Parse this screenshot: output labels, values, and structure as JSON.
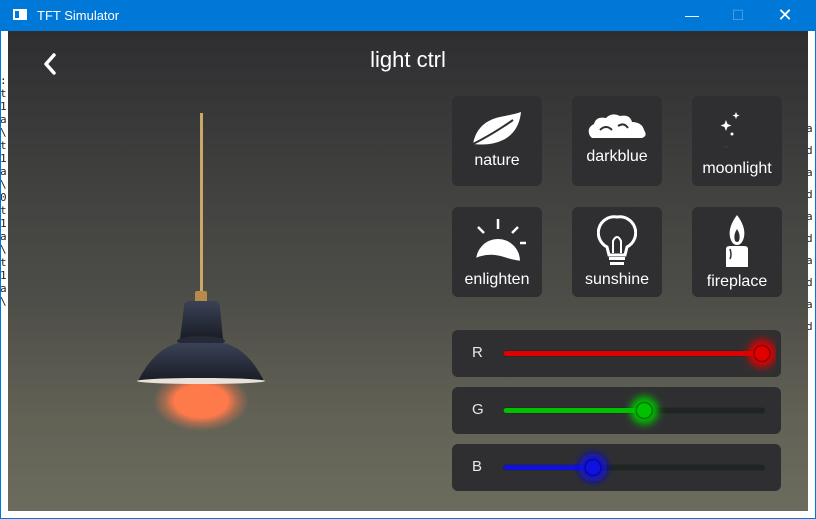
{
  "window": {
    "title": "TFT Simulator",
    "minimize_glyph": "—",
    "maximize_glyph": "☐",
    "close_glyph": "✕"
  },
  "console_left": [
    ":",
    "t",
    "1",
    "a",
    "\\",
    "t",
    "1",
    "a",
    "\\",
    "0",
    "t",
    "1",
    "a",
    "\\",
    "t",
    "1",
    "a",
    "\\"
  ],
  "console_right": [
    "a",
    "d",
    "a",
    "d",
    "a",
    "d",
    "a",
    "d",
    "a",
    "d"
  ],
  "header": {
    "back_icon": "chevron-left-icon",
    "title": "light ctrl"
  },
  "scenes": [
    {
      "label": "nature",
      "icon": "leaf-icon"
    },
    {
      "label": "darkblue",
      "icon": "cloud-icon"
    },
    {
      "label": "moonlight",
      "icon": "moon-icon"
    },
    {
      "label": "enlighten",
      "icon": "sunrise-icon"
    },
    {
      "label": "sunshine",
      "icon": "bulb-icon"
    },
    {
      "label": "fireplace",
      "icon": "candle-icon"
    }
  ],
  "sliders": [
    {
      "channel": "R",
      "value": 1.0,
      "color": "#e00000"
    },
    {
      "channel": "G",
      "value": 0.54,
      "color": "#00c000"
    },
    {
      "channel": "B",
      "value": 0.34,
      "color": "#1010e0"
    }
  ],
  "lamp": {
    "light_color": "#ff7a4a"
  }
}
